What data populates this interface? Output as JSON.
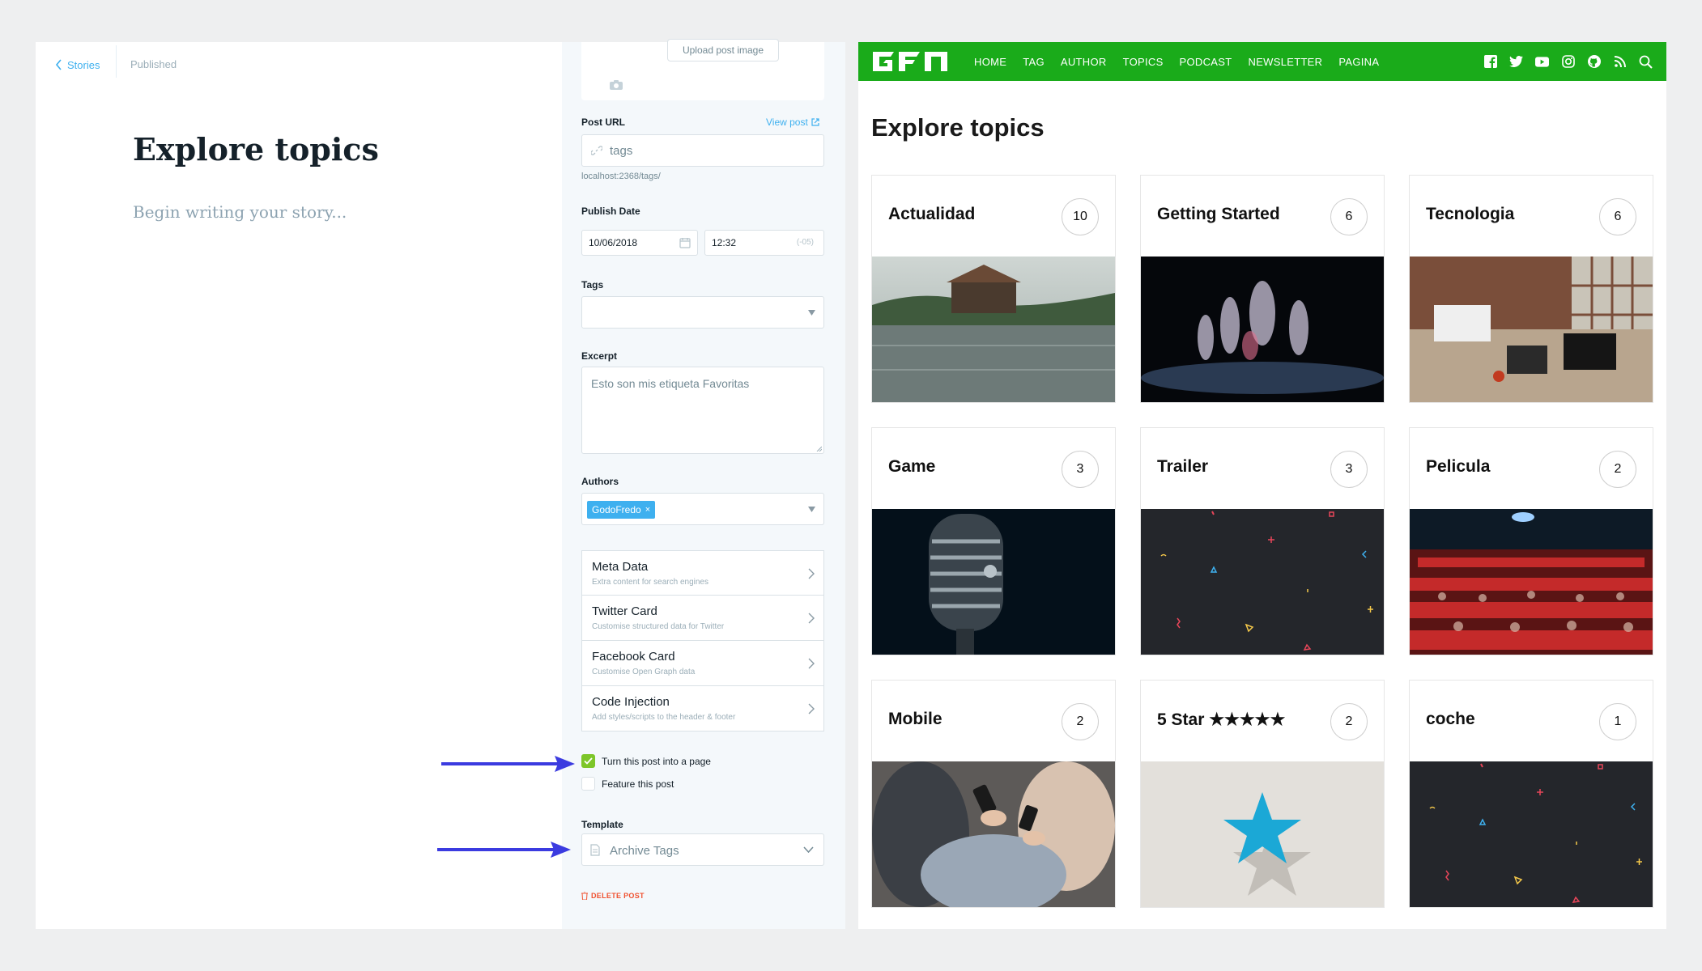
{
  "editor": {
    "back_label": "Stories",
    "status": "Published",
    "title": "Explore topics",
    "body_placeholder": "Begin writing your story..."
  },
  "settings": {
    "upload_label": "Upload post image",
    "post_url_label": "Post URL",
    "view_post_label": "View post",
    "post_url_value": "tags",
    "post_url_hint": "localhost:2368/tags/",
    "publish_date_label": "Publish Date",
    "date_value": "10/06/2018",
    "time_value": "12:32",
    "timezone": "(-05)",
    "tags_label": "Tags",
    "excerpt_label": "Excerpt",
    "excerpt_value": "Esto son mis etiqueta Favoritas",
    "authors_label": "Authors",
    "author_chip": "GodoFredo",
    "items": [
      {
        "title": "Meta Data",
        "subtitle": "Extra content for search engines"
      },
      {
        "title": "Twitter Card",
        "subtitle": "Customise structured data for Twitter"
      },
      {
        "title": "Facebook Card",
        "subtitle": "Customise Open Graph data"
      },
      {
        "title": "Code Injection",
        "subtitle": "Add styles/scripts to the header & footer"
      }
    ],
    "page_checkbox_label": "Turn this post into a page",
    "page_checkbox_checked": true,
    "feature_checkbox_label": "Feature this post",
    "feature_checkbox_checked": false,
    "template_label": "Template",
    "template_value": "Archive Tags",
    "delete_label": "DELETE POST"
  },
  "site": {
    "logo_text": "GFN",
    "nav": [
      "HOME",
      "TAG",
      "AUTHOR",
      "TOPICS",
      "PODCAST",
      "NEWSLETTER",
      "PAGINA"
    ],
    "social_icons": [
      "facebook-icon",
      "twitter-icon",
      "youtube-icon",
      "instagram-icon",
      "github-icon",
      "rss-icon",
      "search-icon"
    ],
    "heading": "Explore topics",
    "cards": [
      {
        "name": "Actualidad",
        "count": "10"
      },
      {
        "name": "Getting Started",
        "count": "6"
      },
      {
        "name": "Tecnologia",
        "count": "6"
      },
      {
        "name": "Game",
        "count": "3"
      },
      {
        "name": "Trailer",
        "count": "3"
      },
      {
        "name": "Pelicula",
        "count": "2"
      },
      {
        "name": "Mobile",
        "count": "2"
      },
      {
        "name": "5 Star ★★★★★",
        "count": "2"
      },
      {
        "name": "coche",
        "count": "1"
      }
    ]
  },
  "colors": {
    "nav_green": "#1aab1a",
    "accent_blue": "#3eb0ef",
    "arrow_blue": "#3b3be0",
    "delete_red": "#f05230"
  }
}
